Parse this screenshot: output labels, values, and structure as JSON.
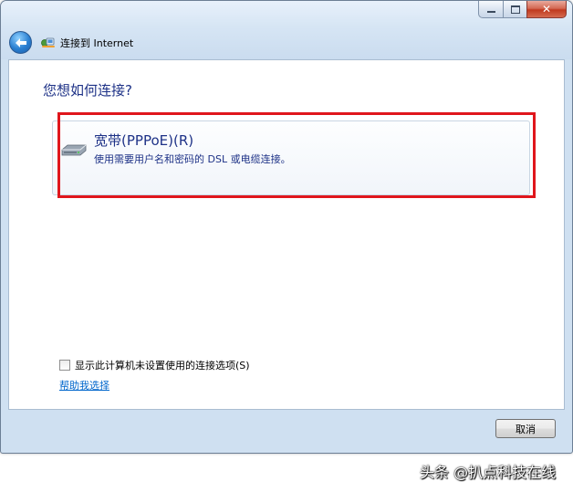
{
  "window": {
    "title": "连接到 Internet",
    "minimize_icon": "minimize-icon",
    "maximize_icon": "maximize-icon",
    "close_glyph": "✕",
    "back_icon": "back-arrow-icon",
    "network_icon": "network-icon"
  },
  "content": {
    "question": "您想如何连接?",
    "option": {
      "title": "宽带(PPPoE)(R)",
      "description": "使用需要用户名和密码的 DSL 或电缆连接。",
      "icon": "modem-icon"
    },
    "checkbox_label": "显示此计算机未设置使用的连接选项(S)",
    "help_link": "帮助我选择"
  },
  "footer": {
    "cancel_label": "取消"
  },
  "watermark": "头条 @扒点科技在线",
  "colors": {
    "heading": "#1e3287",
    "link": "#0066cc",
    "highlight": "#e0161c",
    "frame": "#cfe0f1"
  }
}
